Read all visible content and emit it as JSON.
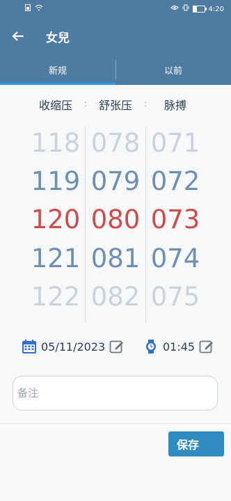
{
  "status_bar": {
    "time": "4:20",
    "battery_level": 0.35
  },
  "app_bar": {
    "title": "女兒"
  },
  "tabs": [
    {
      "label": "新规",
      "active": true
    },
    {
      "label": "以前",
      "active": false
    }
  ],
  "picker": {
    "headers": [
      "收缩压",
      "舒张压",
      "脉搏"
    ],
    "systolic": [
      "118",
      "119",
      "120",
      "121",
      "122"
    ],
    "diastolic": [
      "078",
      "079",
      "080",
      "081",
      "082"
    ],
    "pulse": [
      "071",
      "072",
      "073",
      "074",
      "075"
    ],
    "selected_index": 2
  },
  "date_time": {
    "date": "05/11/2023",
    "time": "01:45"
  },
  "note": {
    "placeholder": "备注",
    "value": ""
  },
  "actions": {
    "save_label": "保存"
  },
  "colors": {
    "primary": "#4e7ba2",
    "tab_indicator": "#2f9cf0",
    "selected_value": "#cf4b4b",
    "adjacent_value": "#6d8fb0",
    "faded_value": "#c9d3de",
    "save_button": "#2e8cc0"
  }
}
